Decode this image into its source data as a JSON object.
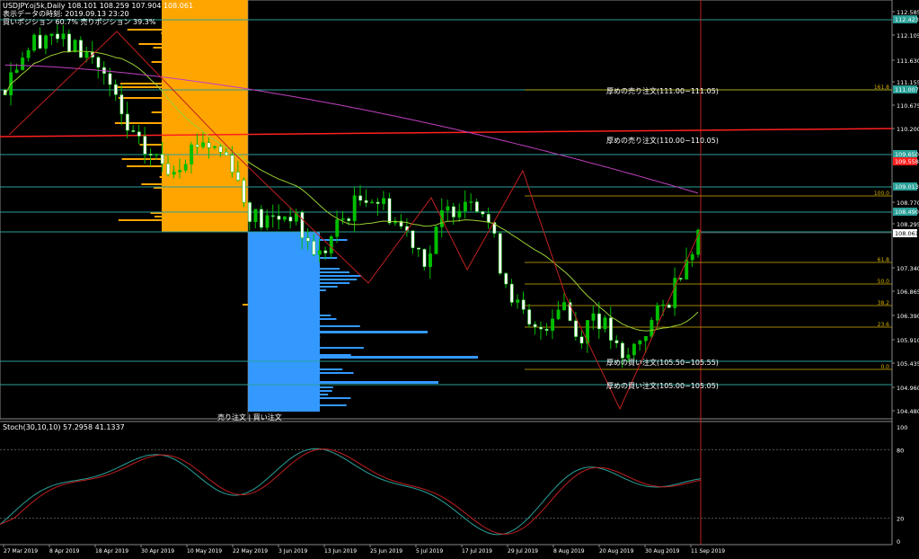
{
  "header": {
    "symbol_line": "USDJPY.oj5k,Daily  108.101 108.259 107.904 108.061",
    "time_line": "表示データの時刻: 2019.09.13 23:20",
    "position_line": "買いポジション 60.7% 売りポジション 39.3%"
  },
  "stoch_label": "Stoch(30,10,10) 57.2958 41.1337",
  "price_axis": {
    "ticks": [
      "112.585",
      "112.105",
      "111.630",
      "111.155",
      "110.675",
      "110.200",
      "108.770",
      "108.295",
      "107.340",
      "106.865",
      "106.390",
      "105.910",
      "105.435",
      "104.960",
      "104.480"
    ],
    "current_price": "108.061",
    "tags": [
      {
        "label": "112.423",
        "color": "#2aa198"
      },
      {
        "label": "111.007",
        "color": "#2aa198"
      },
      {
        "label": "109.650",
        "color": "#2aa198"
      },
      {
        "label": "109.558",
        "color": "#ff2020"
      },
      {
        "label": "109.013",
        "color": "#2aa198"
      },
      {
        "label": "108.490",
        "color": "#2aa198"
      }
    ]
  },
  "stoch_axis": [
    "100",
    "80",
    "20",
    "0"
  ],
  "date_axis": [
    "27 Mar 2019",
    "8 Apr 2019",
    "18 Apr 2019",
    "30 Apr 2019",
    "10 May 2019",
    "22 May 2019",
    "3 Jun 2019",
    "13 Jun 2019",
    "25 Jun 2019",
    "5 Jul 2019",
    "17 Jul 2019",
    "29 Jul 2019",
    "8 Aug 2019",
    "20 Aug 2019",
    "30 Aug 2019",
    "11 Sep 2019"
  ],
  "annotations": {
    "sell_heavy_1": "厚めの売り注文(111.00−111.05)",
    "sell_heavy_2": "厚めの売り注文(110.00−110.05)",
    "buy_heavy_1": "厚めの買い注文(105.50−105.55)",
    "buy_heavy_2": "厚めの買い注文(105.00−105.05)",
    "orders_label": "売り注文 | 買い注文"
  },
  "fib_labels": [
    "161.8",
    "100.0",
    "61.8",
    "50.0",
    "38.2",
    "23.6",
    "0.0"
  ],
  "colors": {
    "sell_orders": "#ffa500",
    "buy_orders": "#3399ff",
    "candle_up": "#00c000",
    "candle_down": "#ffffff",
    "ma_short": "#9acd32",
    "ma_long": "#c040c0",
    "ma_red": "#ff2020",
    "fib": "#d4b000",
    "grid": "#2aa198",
    "stoch_main": "#2aa198",
    "stoch_signal": "#c02020"
  }
}
